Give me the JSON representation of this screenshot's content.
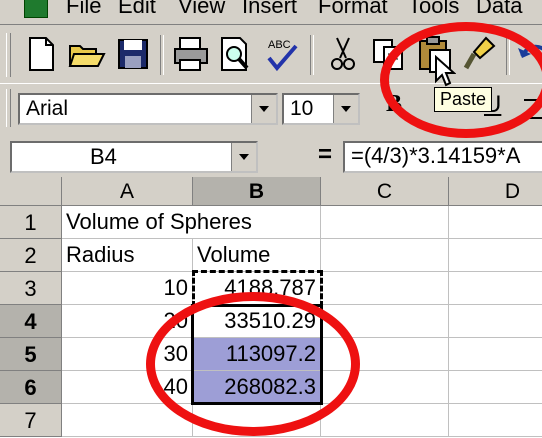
{
  "menu": [
    "File",
    "Edit",
    "View",
    "Insert",
    "Format",
    "Tools",
    "Data"
  ],
  "toolbar": {
    "icons": [
      "new-icon",
      "open-icon",
      "save-icon",
      "print-icon",
      "print-preview-icon",
      "spelling-icon",
      "cut-icon",
      "copy-icon",
      "paste-icon",
      "format-painter-icon",
      "undo-icon"
    ],
    "tooltip": "Paste"
  },
  "format_toolbar": {
    "font": "Arial",
    "size": "10"
  },
  "formula_bar": {
    "name_box": "B4",
    "equals": "=",
    "formula": "=(4/3)*3.14159*A"
  },
  "columns": [
    "A",
    "B",
    "C",
    "D"
  ],
  "rows": [
    {
      "num": "1",
      "a": "Volume of Spheres",
      "b": ""
    },
    {
      "num": "2",
      "a": "Radius",
      "b": "Volume"
    },
    {
      "num": "3",
      "a": "10",
      "b": "4188.787"
    },
    {
      "num": "4",
      "a": "20",
      "b": "33510.29"
    },
    {
      "num": "5",
      "a": "30",
      "b": "113097.2"
    },
    {
      "num": "6",
      "a": "40",
      "b": "268082.3"
    },
    {
      "num": "7",
      "a": "",
      "b": ""
    }
  ],
  "colors": {
    "selection": "#9d9ed6",
    "annotation": "#ee1111"
  }
}
